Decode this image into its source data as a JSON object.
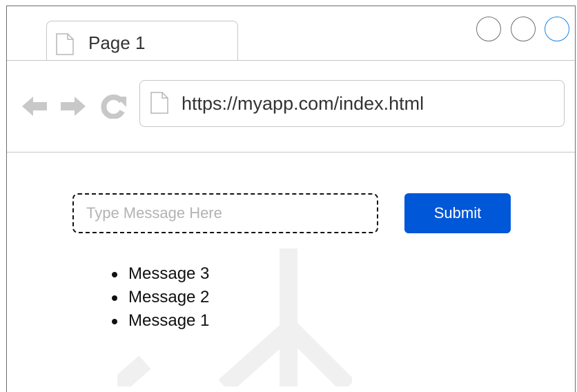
{
  "browser": {
    "tab": {
      "title": "Page 1",
      "icon": "page-icon"
    },
    "window_controls": [
      "minimize",
      "maximize",
      "close"
    ],
    "nav": {
      "back_icon": "back-arrow-icon",
      "forward_icon": "forward-arrow-icon",
      "reload_icon": "reload-icon"
    },
    "address_bar": {
      "url": "https://myapp.com/index.html",
      "icon": "page-icon"
    }
  },
  "main": {
    "message_input": {
      "value": "",
      "placeholder": "Type Message Here"
    },
    "submit_label": "Submit",
    "messages": [
      "Message 3",
      "Message 2",
      "Message 1"
    ]
  },
  "colors": {
    "accent": "#0057D8",
    "close_button": "#1A86E8",
    "border": "#C6C6C6",
    "icon_gray": "#C8C8C8"
  }
}
